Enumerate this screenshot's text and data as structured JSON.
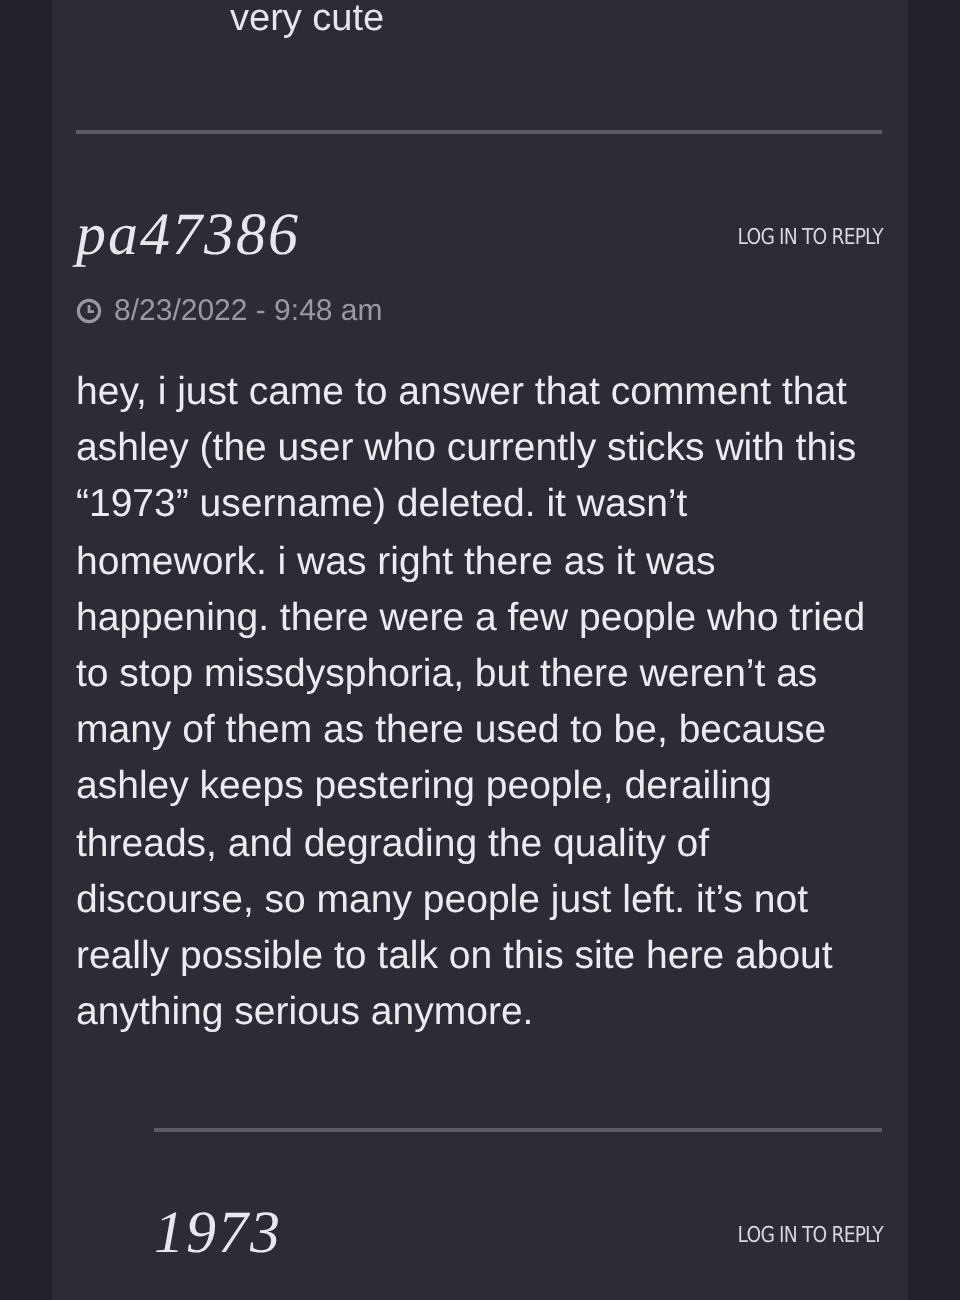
{
  "previous_comment": {
    "text": "very cute"
  },
  "comments": [
    {
      "author": "pa47386",
      "reply_link": "LOG IN TO REPLY",
      "date": "8/23/2022 - 9:48 am",
      "text": "hey, i just came to answer that comment that ashley (the user who currently sticks with this “1973” username) deleted. it wasn’t homework. i was right there as it was happening. there were a few people who tried to stop missdysphoria, but there weren’t as many of them as there used to be, because ashley keeps pestering people, derailing threads, and degrading the quality of discourse, so many people just left. it’s not really possible to talk on this site here about anything serious anymore.",
      "children": [
        {
          "author": "1973",
          "reply_link": "LOG IN TO REPLY"
        }
      ]
    }
  ]
}
